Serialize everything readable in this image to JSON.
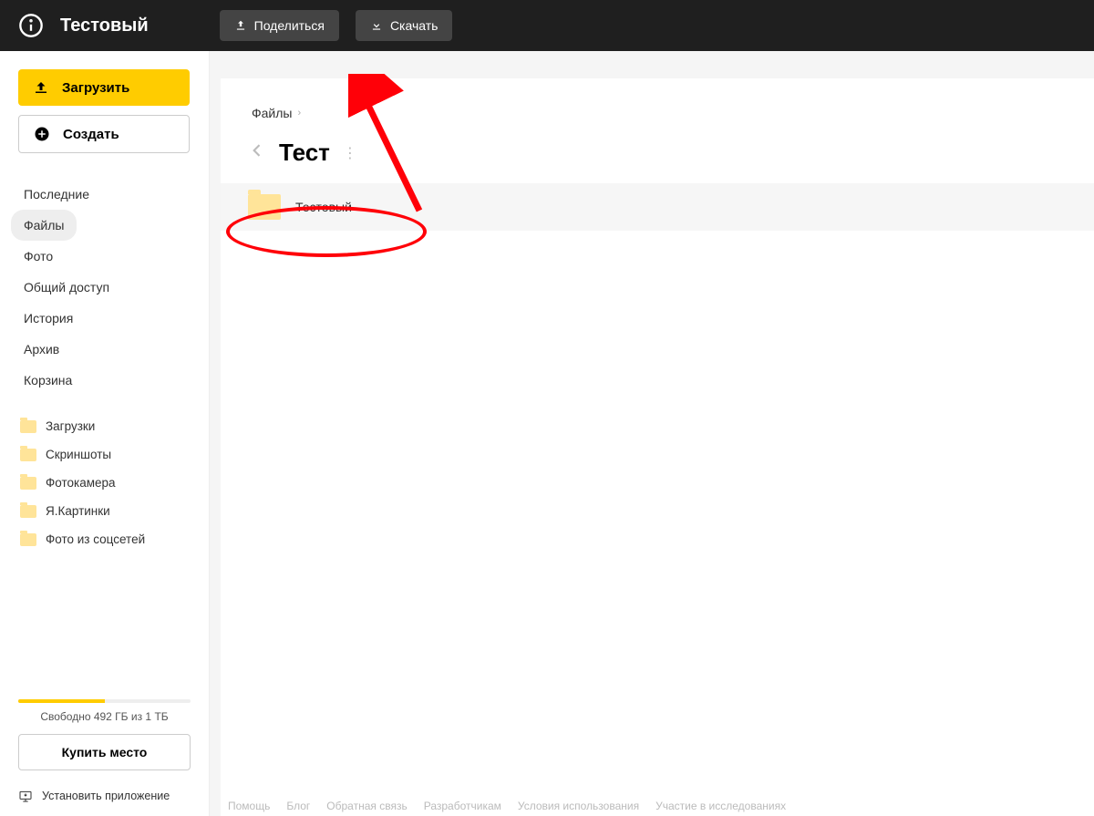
{
  "topbar": {
    "title": "Тестовый",
    "share_label": "Поделиться",
    "download_label": "Скачать"
  },
  "sidebar": {
    "upload_label": "Загрузить",
    "create_label": "Создать",
    "nav": [
      {
        "label": "Последние",
        "active": false
      },
      {
        "label": "Файлы",
        "active": true
      },
      {
        "label": "Фото",
        "active": false
      },
      {
        "label": "Общий доступ",
        "active": false
      },
      {
        "label": "История",
        "active": false
      },
      {
        "label": "Архив",
        "active": false
      },
      {
        "label": "Корзина",
        "active": false
      }
    ],
    "folders": [
      {
        "label": "Загрузки"
      },
      {
        "label": "Скриншоты"
      },
      {
        "label": "Фотокамера"
      },
      {
        "label": "Я.Картинки"
      },
      {
        "label": "Фото из соцсетей"
      }
    ],
    "storage_text": "Свободно 492 ГБ из 1 ТБ",
    "storage_fill_pct": 50,
    "buy_label": "Купить место",
    "install_label": "Установить приложение"
  },
  "main": {
    "breadcrumb_root": "Файлы",
    "folder_title": "Тест",
    "items": [
      {
        "name": "Тестовый"
      }
    ]
  },
  "footer": {
    "links": [
      "Помощь",
      "Блог",
      "Обратная связь",
      "Разработчикам",
      "Условия использования",
      "Участие в исследованиях"
    ]
  },
  "colors": {
    "accent": "#ffcc00",
    "topbar_bg": "#1f1f1f",
    "annotation": "#ff0008"
  }
}
